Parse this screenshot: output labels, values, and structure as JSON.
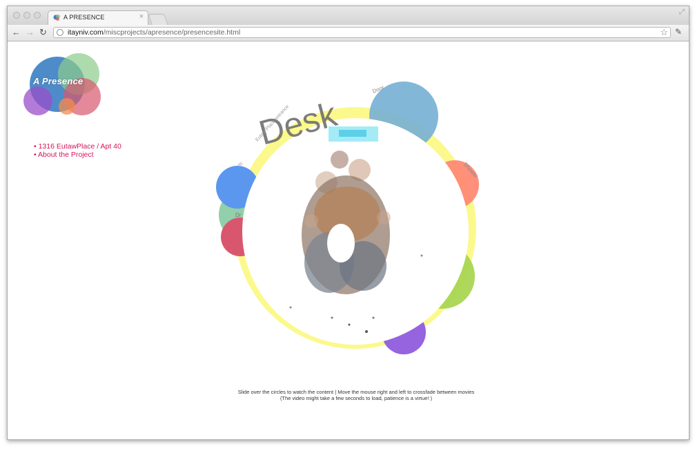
{
  "browser": {
    "tab_title": "A PRESENCE",
    "tab_close": "×",
    "url_host": "itayniv.com",
    "url_path": "/miscprojects/apresence/presencesite.html",
    "back_icon": "←",
    "forward_icon": "→",
    "reload_icon": "↻",
    "bookmark_icon": "☆",
    "wrench_icon": "✎",
    "fullscreen_icon": "⤢"
  },
  "site": {
    "logo_text": "A Presence",
    "nav": [
      "• 1316 EutawPlace / Apt 40",
      "• About the Project"
    ],
    "big_label": "Desk",
    "circle_labels": {
      "door": "Door",
      "shower": "Shower",
      "eutaw": "Eutaw Place entrance",
      "m": "m",
      "dr": "Dr"
    },
    "instructions": [
      "Slide over the circles to watch the content | Move the mouse right and left to crossfade between movies",
      "(The video might take a few seconds to load, patience is a virtue! )"
    ]
  },
  "colors": {
    "ring": "#fbf98c",
    "door": "#76afd4",
    "shower": "#ff8a75",
    "green": "#a9d652",
    "purple": "#9564de",
    "blue": "#5b97ee",
    "teal": "#8ccca6",
    "red": "#d9576e",
    "link": "#d4145a"
  }
}
